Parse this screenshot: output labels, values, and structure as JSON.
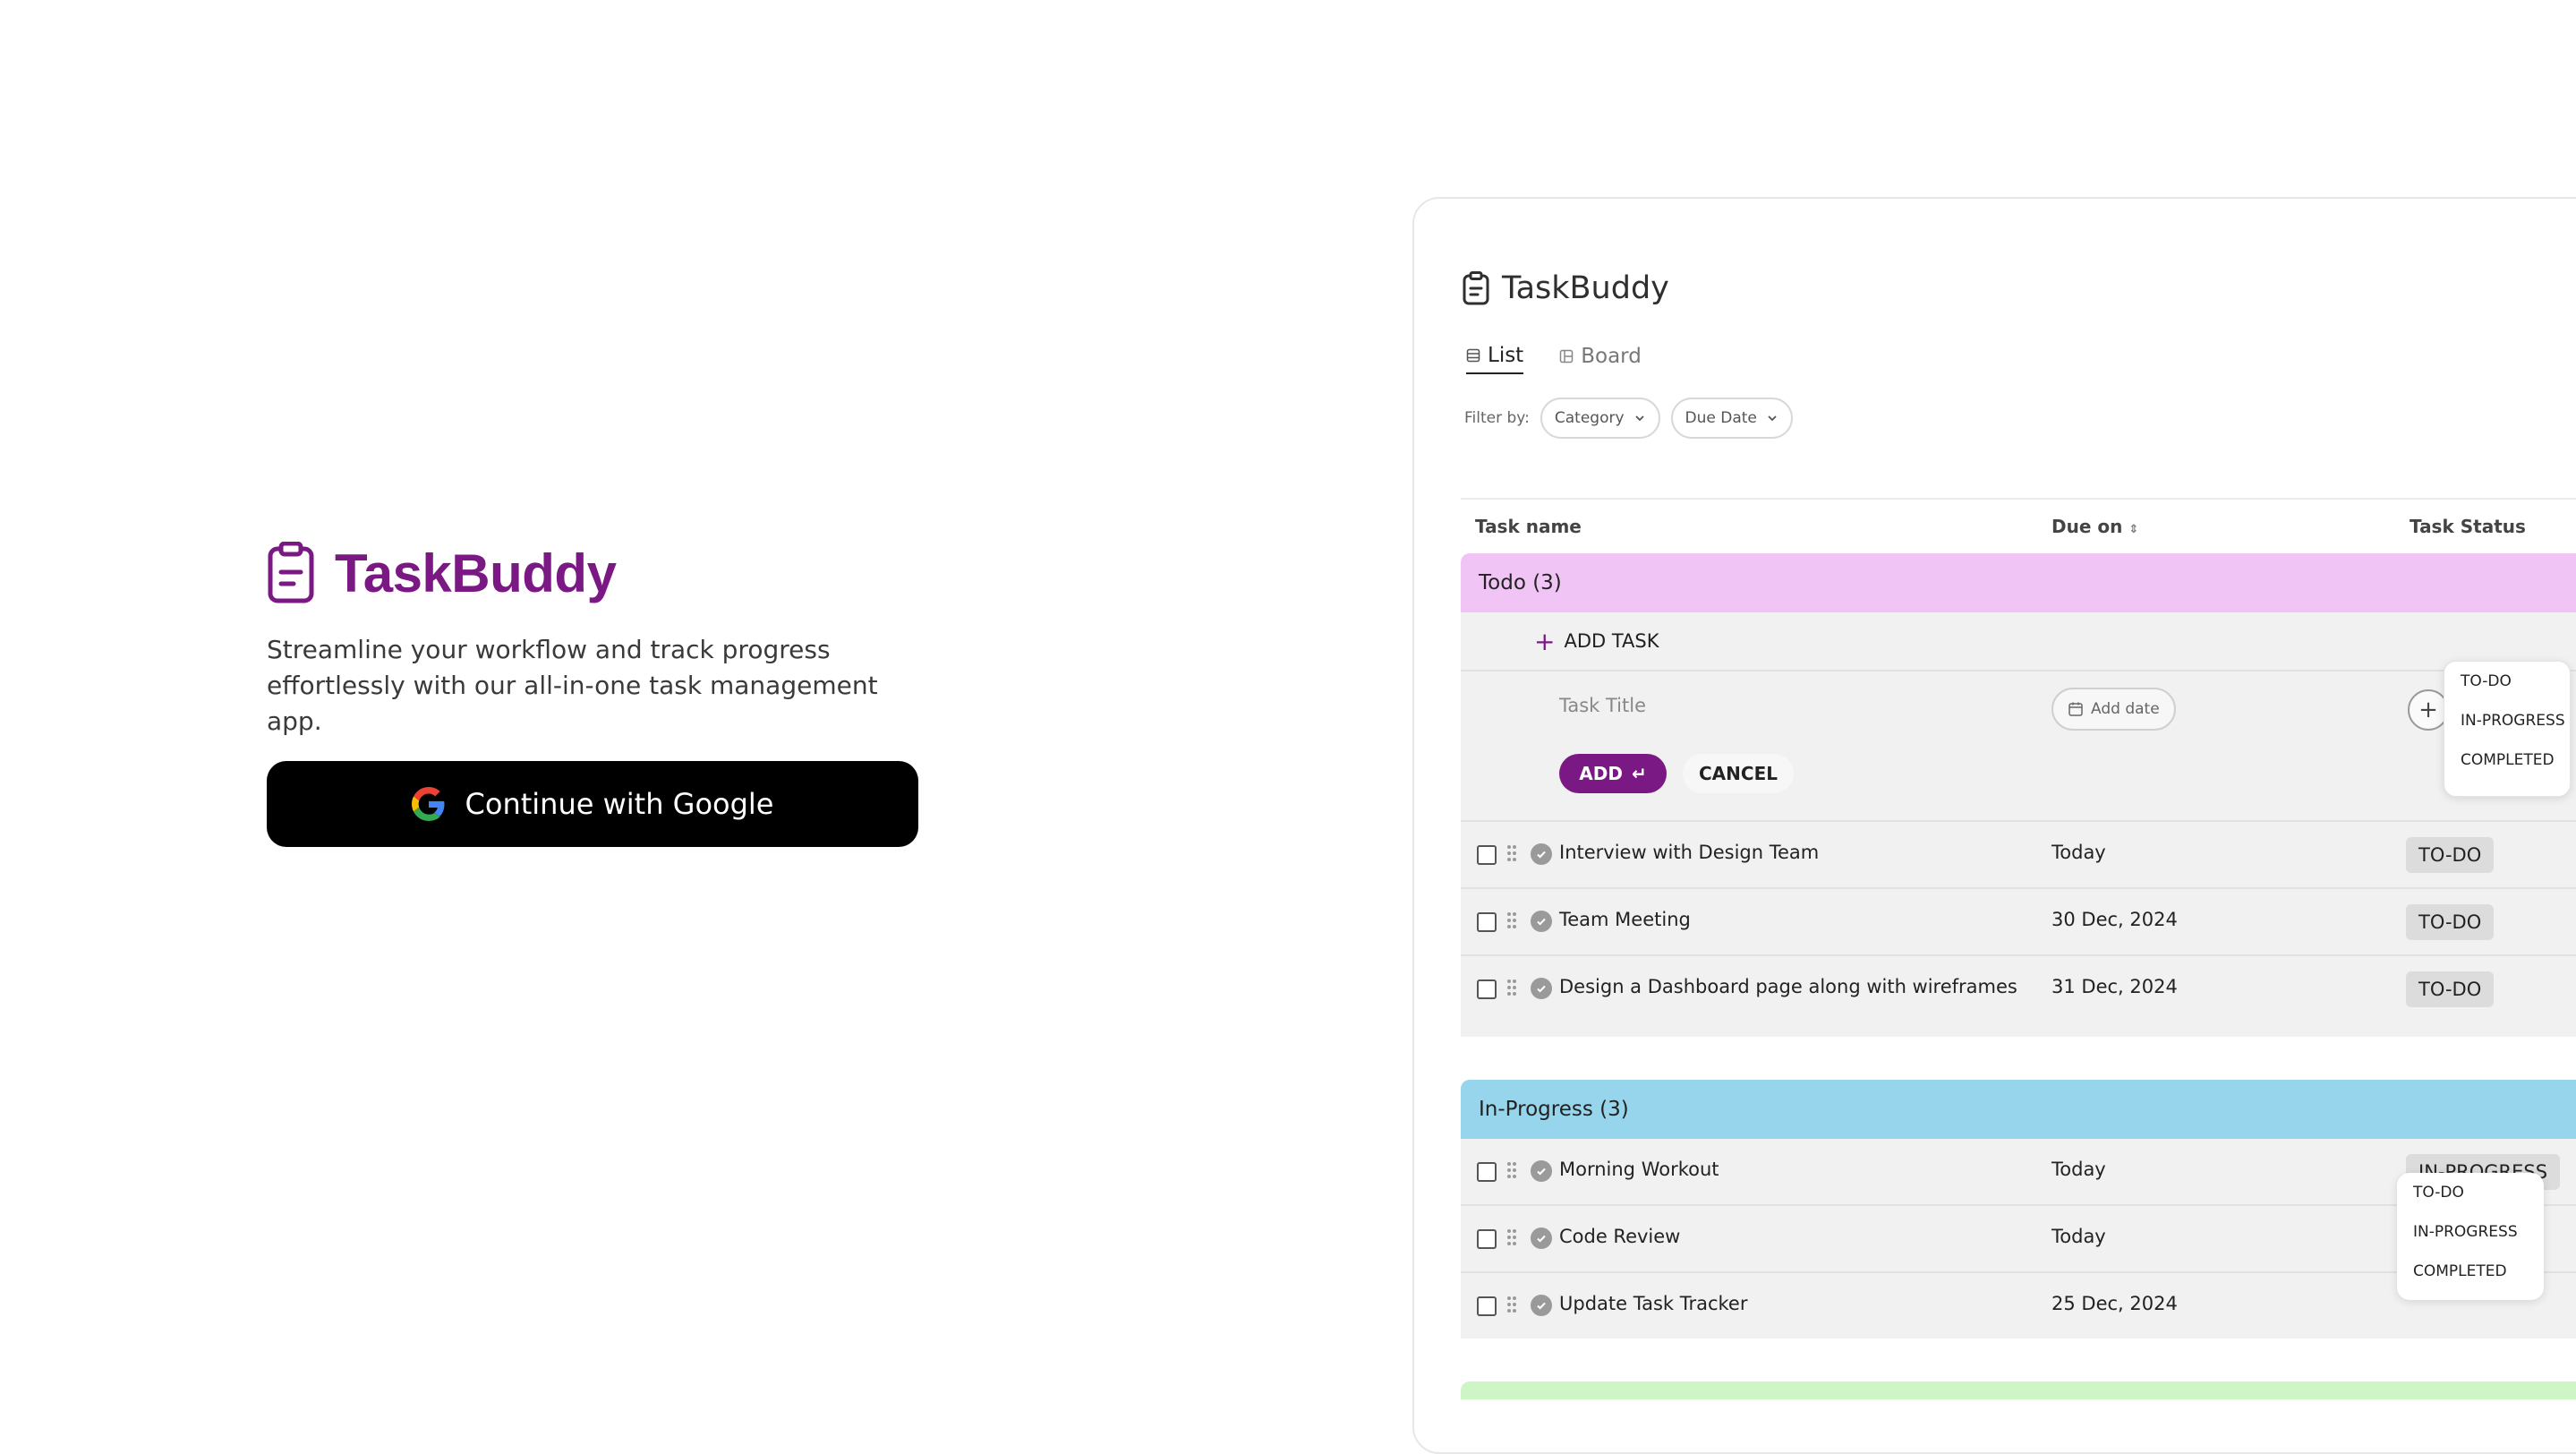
{
  "hero": {
    "brand": "TaskBuddy",
    "tagline": "Streamline your workflow and track progress effortlessly with our all-in-one task management app.",
    "google_button": "Continue with Google",
    "brand_color": "#7b1984"
  },
  "preview": {
    "app_title": "TaskBuddy",
    "views": [
      "List",
      "Board"
    ],
    "filter_label": "Filter by:",
    "filters": [
      "Category",
      "Due Date"
    ],
    "columns": {
      "name": "Task name",
      "due": "Due on",
      "status": "Task Status"
    },
    "todo": {
      "title": "Todo (3)",
      "add_task": "ADD TASK",
      "new_task_placeholder": "Task Title",
      "add_date": "Add date",
      "add_button": "ADD",
      "cancel_button": "CANCEL",
      "status_options": [
        "TO-DO",
        "IN-PROGRESS",
        "COMPLETED"
      ],
      "tasks": [
        {
          "name": "Interview with Design Team",
          "due": "Today",
          "status": "TO-DO"
        },
        {
          "name": "Team Meeting",
          "due": "30 Dec, 2024",
          "status": "TO-DO"
        },
        {
          "name": "Design a Dashboard page along with wireframes",
          "due": "31 Dec, 2024",
          "status": "TO-DO"
        }
      ]
    },
    "in_progress": {
      "title": "In-Progress (3)",
      "status_options": [
        "TO-DO",
        "IN-PROGRESS",
        "COMPLETED"
      ],
      "tasks": [
        {
          "name": "Morning Workout",
          "due": "Today",
          "status": "IN-PROGRESS"
        },
        {
          "name": "Code Review",
          "due": "Today",
          "status": ""
        },
        {
          "name": "Update Task Tracker",
          "due": "25 Dec, 2024",
          "status": ""
        }
      ]
    }
  }
}
